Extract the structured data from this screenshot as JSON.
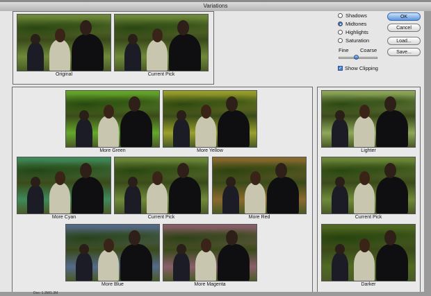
{
  "window": {
    "title": "Variations"
  },
  "top_tiles": [
    {
      "label": "Original",
      "tint": "#6f8a3a"
    },
    {
      "label": "Current Pick",
      "tint": "#6f8a3a"
    }
  ],
  "variation_tiles": [
    {
      "label": "More Green",
      "tint": "#64a82a"
    },
    {
      "label": "More Yellow",
      "tint": "#9aa02a"
    },
    {
      "label": "More Cyan",
      "tint": "#3e8a5a"
    },
    {
      "label": "Current Pick",
      "tint": "#6f8a3a"
    },
    {
      "label": "More Red",
      "tint": "#8a6a2e"
    },
    {
      "label": "More Blue",
      "tint": "#546a8a"
    },
    {
      "label": "More Magenta",
      "tint": "#8a5e6a"
    }
  ],
  "brightness_tiles": [
    {
      "label": "Lighter",
      "tint": "#8ea85a"
    },
    {
      "label": "Current Pick",
      "tint": "#6f8a3a"
    },
    {
      "label": "Darker",
      "tint": "#506a22"
    }
  ],
  "options": {
    "radios": [
      {
        "label": "Shadows",
        "selected": false
      },
      {
        "label": "Midtones",
        "selected": true
      },
      {
        "label": "Highlights",
        "selected": false
      },
      {
        "label": "Saturation",
        "selected": false
      }
    ],
    "fine_label": "Fine",
    "coarse_label": "Coarse",
    "slider_value": 0.45,
    "show_clipping_label": "Show Clipping",
    "show_clipping_checked": true
  },
  "buttons": {
    "ok": "OK",
    "cancel": "Cancel",
    "load": "Load...",
    "save": "Save..."
  },
  "status": {
    "text": "Doc: 1.3M/1.3M"
  }
}
